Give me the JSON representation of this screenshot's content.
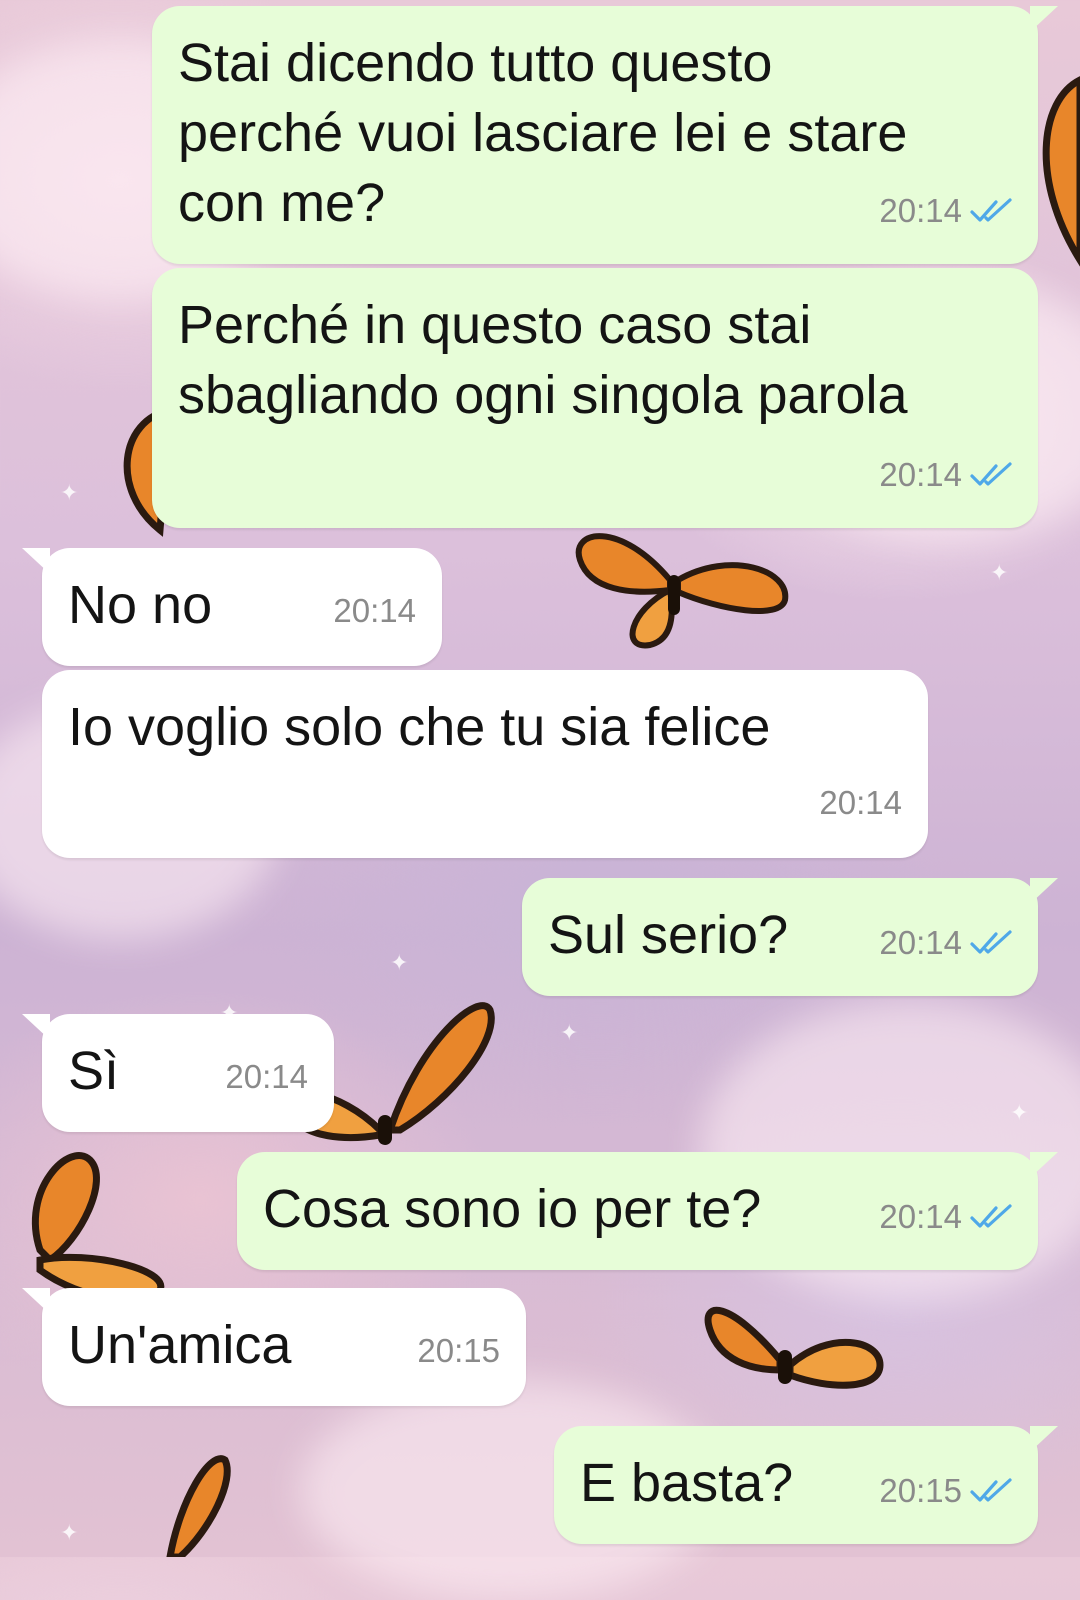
{
  "colors": {
    "outgoing_bubble": "#e7fdd8",
    "incoming_bubble": "#ffffff",
    "timestamp": "#8a8a8a",
    "read_ticks": "#4fa8e8"
  },
  "icons": {
    "read_receipt": "double-check-icon",
    "wallpaper": "monarch-butterfly-icon"
  },
  "messages": [
    {
      "direction": "out",
      "text": "Stai dicendo tutto questo\nperché vuoi lasciare lei e stare\ncon me?",
      "time": "20:14",
      "read": true
    },
    {
      "direction": "out",
      "text": "Perché in questo caso stai\nsbagliando ogni singola parola",
      "time": "20:14",
      "read": true
    },
    {
      "direction": "in",
      "text": "No no",
      "time": "20:14"
    },
    {
      "direction": "in",
      "text": "Io voglio solo che tu sia felice",
      "time": "20:14"
    },
    {
      "direction": "out",
      "text": "Sul serio?",
      "time": "20:14",
      "read": true
    },
    {
      "direction": "in",
      "text": "Sì",
      "time": "20:14"
    },
    {
      "direction": "out",
      "text": "Cosa sono io per te?",
      "time": "20:14",
      "read": true
    },
    {
      "direction": "in",
      "text": "Un'amica",
      "time": "20:15"
    },
    {
      "direction": "out",
      "text": "E basta?",
      "time": "20:15",
      "read": true
    }
  ]
}
